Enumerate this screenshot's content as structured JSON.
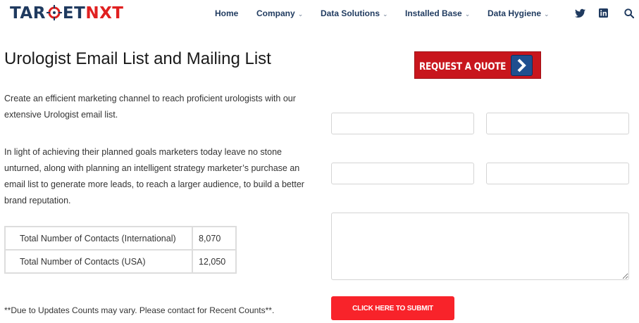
{
  "header": {
    "logo": {
      "part1": "TAR",
      "part2": "ET",
      "part3": "NXT"
    },
    "nav": [
      {
        "label": "Home",
        "dropdown": false
      },
      {
        "label": "Company",
        "dropdown": true
      },
      {
        "label": "Data Solutions",
        "dropdown": true
      },
      {
        "label": "Installed Base",
        "dropdown": true
      },
      {
        "label": "Data Hygiene",
        "dropdown": true
      }
    ],
    "icons": [
      "twitter-icon",
      "linkedin-icon",
      "search-icon"
    ]
  },
  "main": {
    "title": "Urologist Email List and Mailing List",
    "intro": "Create an efficient marketing channel to reach proficient urologists with our extensive Urologist email list.",
    "body": "In light of achieving their planned goals marketers today leave no stone unturned, along with planning an intelligent strategy marketer’s purchase an email list to generate more leads, to reach a larger audience, to build a better brand reputation.",
    "counts": [
      {
        "label": "Total Number of Contacts (International)",
        "value": "8,070"
      },
      {
        "label": "Total Number of Contacts (USA)",
        "value": "12,050"
      }
    ],
    "footnote": "**Due to Updates Counts may vary. Please contact for Recent Counts**."
  },
  "form": {
    "banner": "REQUEST A QUOTE",
    "fields": {
      "field1": "",
      "field2": "",
      "field3": "",
      "field4": "",
      "message": ""
    },
    "submit": "CLICK HERE TO SUBMIT"
  },
  "colors": {
    "brand_navy": "#1f3a5f",
    "brand_red": "#e02020",
    "submit_red": "#f8232a",
    "banner_red": "#c8161d",
    "arrow_blue": "#1f4f8f"
  }
}
